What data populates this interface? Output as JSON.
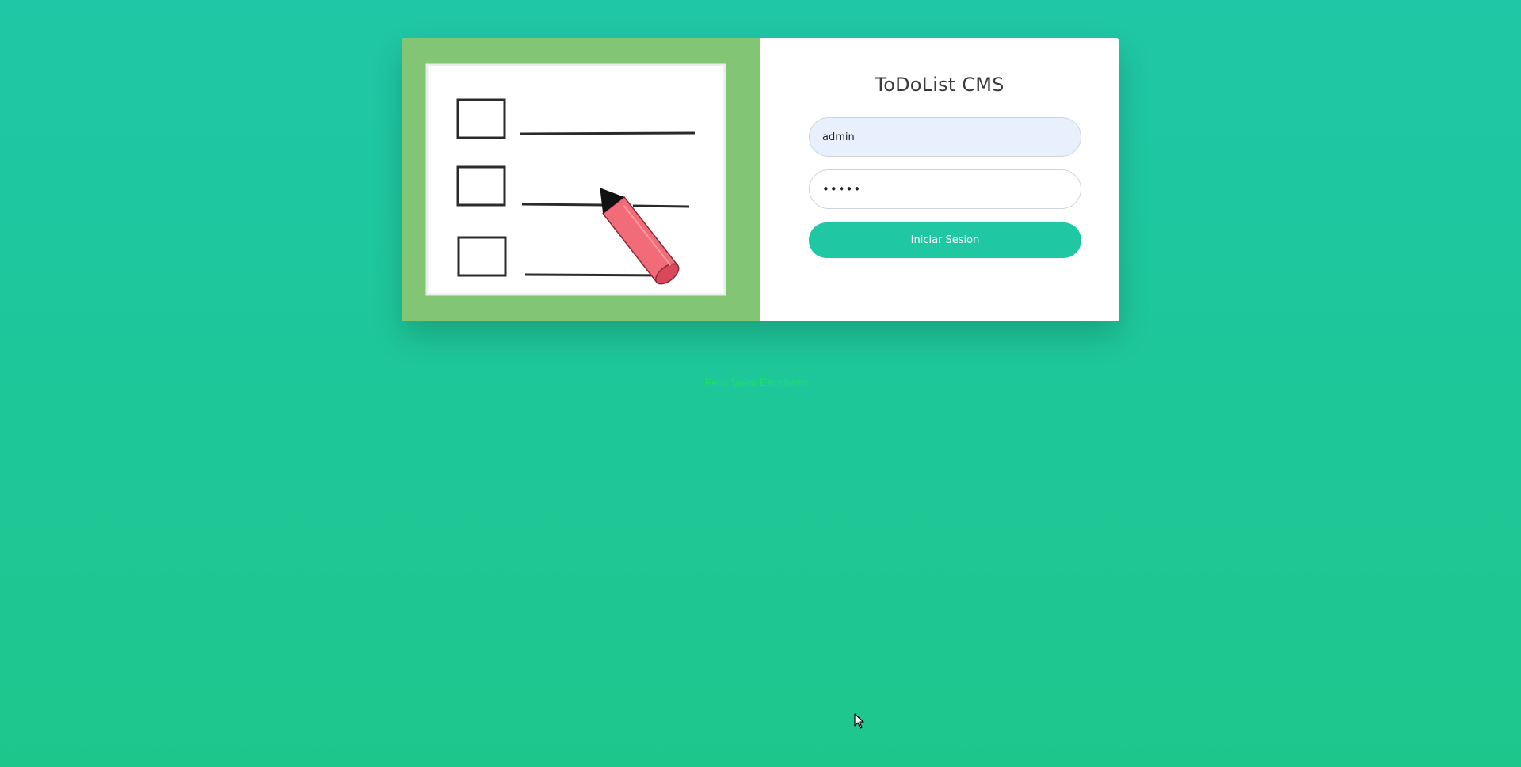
{
  "login": {
    "title": "ToDoList CMS",
    "username_value": "admin",
    "password_value": "•••••",
    "submit_label": "Iniciar Sesion"
  },
  "footer": {
    "credit": "Felix Valor Escribano"
  },
  "illustration": {
    "icon": "checklist-pencil-icon"
  },
  "colors": {
    "background": "#1fc7a6",
    "illustration_panel": "#82c574",
    "accent": "#1fc7a3",
    "footer_text": "#19e25a"
  }
}
